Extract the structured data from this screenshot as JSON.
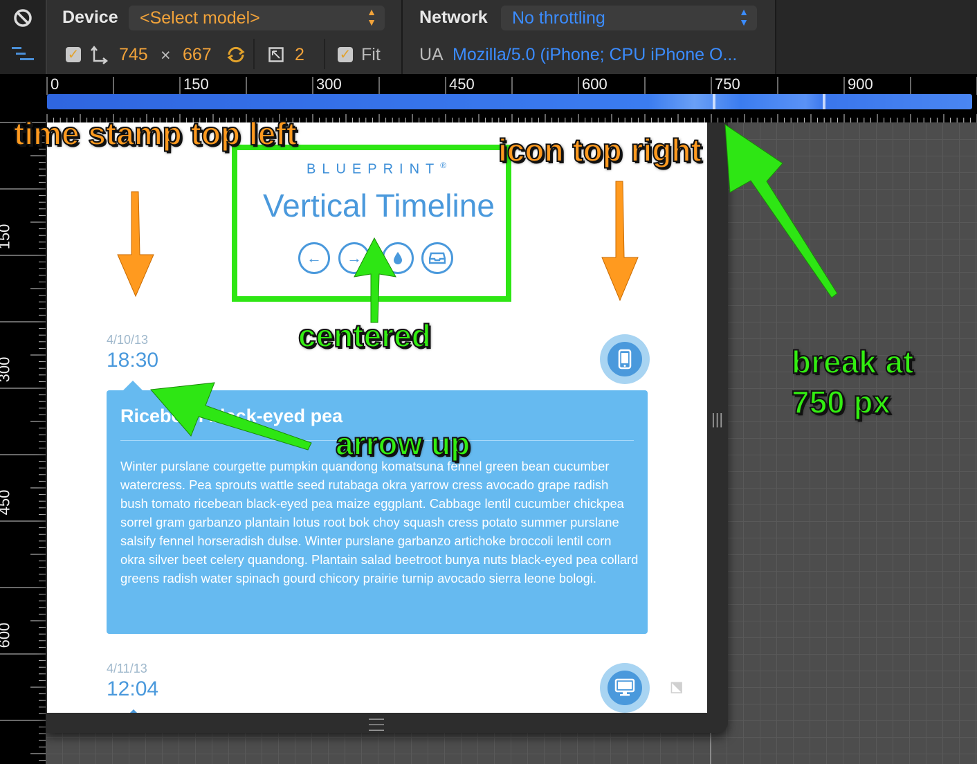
{
  "toolbar": {
    "device_label": "Device",
    "model_select": "<Select model>",
    "network_label": "Network",
    "throttling_select": "No throttling",
    "width": "745",
    "times": "×",
    "height": "667",
    "dpr": "2",
    "fit_label": "Fit",
    "ua_label": "UA",
    "ua_value": "Mozilla/5.0 (iPhone; CPU iPhone O..."
  },
  "ruler": {
    "top_labels": [
      "0",
      "150",
      "300",
      "450",
      "600",
      "750",
      "900"
    ],
    "left_labels": [
      "150",
      "300",
      "450",
      "600"
    ]
  },
  "page": {
    "brand": "BLUEPRINT",
    "brand_mark": "®",
    "title": "Vertical Timeline",
    "entries": [
      {
        "date": "4/10/13",
        "time": "18:30",
        "title": "Ricebean black-eyed pea",
        "body": "Winter purslane courgette pumpkin quandong komatsuna fennel green bean cucumber watercress. Pea sprouts wattle seed rutabaga okra yarrow cress avocado grape radish bush tomato ricebean black-eyed pea maize eggplant. Cabbage lentil cucumber chickpea sorrel gram garbanzo plantain lotus root bok choy squash cress potato summer purslane salsify fennel horseradish dulse. Winter purslane garbanzo artichoke broccoli lentil corn okra silver beet celery quandong. Plantain salad beetroot bunya nuts black-eyed pea collard greens radish water spinach gourd chicory prairie turnip avocado sierra leone bologi."
      },
      {
        "date": "4/11/13",
        "time": "12:04"
      }
    ]
  },
  "annotations": {
    "time_stamp": "time stamp top left",
    "icon_top_right": "icon top right",
    "centered": "centered",
    "arrow_up": "arrow up",
    "break_line1": "break at",
    "break_line2": "750 px"
  },
  "colors": {
    "accent": "#4a99dc",
    "card": "#66baf0",
    "annotation_orange": "#ff9a1f",
    "annotation_green": "#33ee11"
  }
}
